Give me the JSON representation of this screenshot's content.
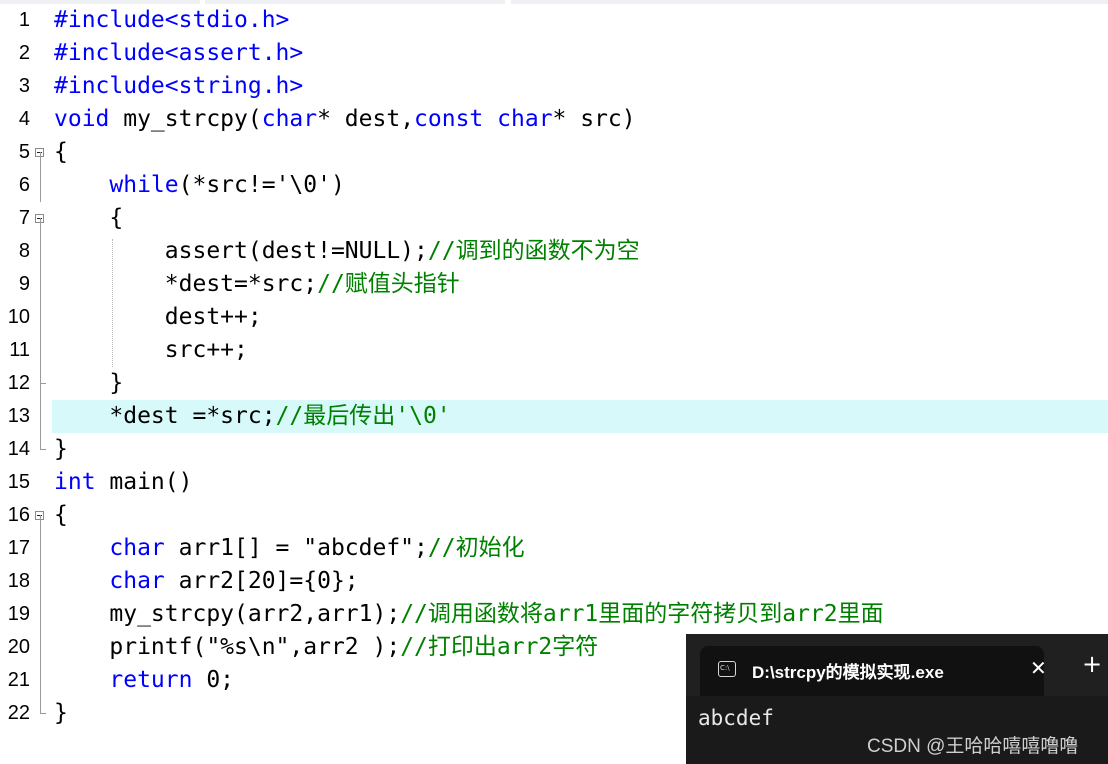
{
  "editor": {
    "lines": [
      {
        "num": "1",
        "code": [
          {
            "t": "#include<stdio.h>",
            "c": "kw"
          }
        ]
      },
      {
        "num": "2",
        "code": [
          {
            "t": "#include<assert.h>",
            "c": "kw"
          }
        ]
      },
      {
        "num": "3",
        "code": [
          {
            "t": "#include<string.h>",
            "c": "kw"
          }
        ]
      },
      {
        "num": "4",
        "code": [
          {
            "t": "void",
            "c": "kw"
          },
          {
            "t": " my_strcpy("
          },
          {
            "t": "char",
            "c": "kw"
          },
          {
            "t": "* dest,"
          },
          {
            "t": "const",
            "c": "kw"
          },
          {
            "t": " "
          },
          {
            "t": "char",
            "c": "kw"
          },
          {
            "t": "* src)"
          }
        ]
      },
      {
        "num": "5",
        "code": [
          {
            "t": "{"
          }
        ]
      },
      {
        "num": "6",
        "code": [
          {
            "t": "    "
          },
          {
            "t": "while",
            "c": "kw"
          },
          {
            "t": "(*src!='\\0')"
          }
        ]
      },
      {
        "num": "7",
        "code": [
          {
            "t": "    {"
          }
        ]
      },
      {
        "num": "8",
        "code": [
          {
            "t": "        assert(dest!=NULL);"
          },
          {
            "t": "//调到的函数不为空",
            "c": "cm"
          }
        ]
      },
      {
        "num": "9",
        "code": [
          {
            "t": "        *dest=*src;"
          },
          {
            "t": "//赋值头指针",
            "c": "cm"
          }
        ]
      },
      {
        "num": "10",
        "code": [
          {
            "t": "        dest++;"
          }
        ]
      },
      {
        "num": "11",
        "code": [
          {
            "t": "        src++;"
          }
        ]
      },
      {
        "num": "12",
        "code": [
          {
            "t": "    }"
          }
        ]
      },
      {
        "num": "13",
        "code": [
          {
            "t": "    *dest =*src;"
          },
          {
            "t": "//最后传出'\\0'",
            "c": "cm"
          }
        ]
      },
      {
        "num": "14",
        "code": [
          {
            "t": "}"
          }
        ]
      },
      {
        "num": "15",
        "code": [
          {
            "t": "int",
            "c": "kw"
          },
          {
            "t": " main()"
          }
        ]
      },
      {
        "num": "16",
        "code": [
          {
            "t": "{"
          }
        ]
      },
      {
        "num": "17",
        "code": [
          {
            "t": "    "
          },
          {
            "t": "char",
            "c": "kw"
          },
          {
            "t": " arr1[] = \"abcdef\";"
          },
          {
            "t": "//初始化",
            "c": "cm"
          }
        ]
      },
      {
        "num": "18",
        "code": [
          {
            "t": "    "
          },
          {
            "t": "char",
            "c": "kw"
          },
          {
            "t": " arr2[20]={0};"
          }
        ]
      },
      {
        "num": "19",
        "code": [
          {
            "t": "    my_strcpy(arr2,arr1);"
          },
          {
            "t": "//调用函数将arr1里面的字符拷贝到arr2里面",
            "c": "cm"
          }
        ]
      },
      {
        "num": "20",
        "code": [
          {
            "t": "    printf(\"%s\\n\",arr2 );"
          },
          {
            "t": "//打印出arr2字符",
            "c": "cm"
          }
        ]
      },
      {
        "num": "21",
        "code": [
          {
            "t": "    "
          },
          {
            "t": "return",
            "c": "kw"
          },
          {
            "t": " 0;"
          }
        ]
      },
      {
        "num": "22",
        "code": [
          {
            "t": "}"
          }
        ]
      }
    ],
    "highlighted_line": "13"
  },
  "console": {
    "title": "D:\\strcpy的模拟实现.exe",
    "icon": "console-app-icon",
    "close_glyph": "✕",
    "newtab_glyph": "+",
    "output": "abcdef"
  },
  "watermark": "CSDN @王哈哈嘻嘻噜噜",
  "colors": {
    "keyword": "#0000ff",
    "comment": "#008000",
    "highlight": "#d7f9fa",
    "console_bg": "#1a1a1a"
  }
}
